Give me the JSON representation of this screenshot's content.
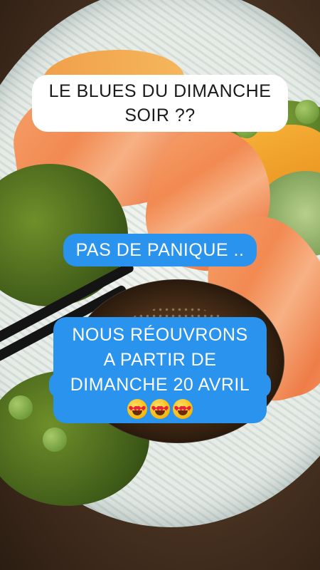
{
  "story": {
    "title_line1": "LE BLUES DU DIMANCHE",
    "title_line2": "SOIR ??",
    "panic": "PAS DE PANIQUE ..",
    "reopen_line1": "NOUS RÉOUVRONS",
    "reopen_line2": "A PARTIR DE",
    "reopen_line3": "DIMANCHE 20 AVRIL",
    "emojis": [
      "heart-eyes-emoji",
      "heart-eyes-emoji",
      "heart-eyes-emoji"
    ]
  },
  "colors": {
    "title_bg": "#ffffff",
    "title_text": "#1a1a1a",
    "sticker_bg": "#2a93ee",
    "sticker_text": "#ffffff"
  }
}
